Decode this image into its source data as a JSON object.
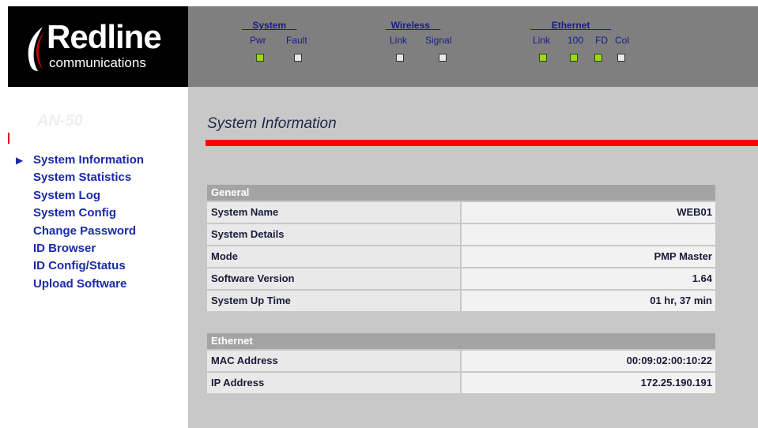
{
  "brand": {
    "name": "Redline",
    "tagline": "communications"
  },
  "status": {
    "groups": [
      {
        "title": "__System__",
        "items": [
          {
            "label": "Pwr",
            "state": "on"
          },
          {
            "label": "Fault",
            "state": "off"
          }
        ]
      },
      {
        "title": "_Wireless__",
        "items": [
          {
            "label": "Link",
            "state": "off"
          },
          {
            "label": "Signal",
            "state": "off"
          }
        ]
      },
      {
        "title": "____Ethernet____",
        "items": [
          {
            "label": "Link",
            "state": "on"
          },
          {
            "label": "100",
            "state": "on"
          },
          {
            "label": "FD",
            "state": "on"
          },
          {
            "label": "Col",
            "state": "off"
          }
        ]
      }
    ],
    "colors": {
      "led_on": "#9dd61a",
      "led_off": "#e8e8e8"
    }
  },
  "sidebar": {
    "model": "AN-50",
    "items": [
      {
        "label": "System Information",
        "active": true
      },
      {
        "label": "System Statistics"
      },
      {
        "label": "System Log"
      },
      {
        "label": "System Config"
      },
      {
        "label": "Change Password"
      },
      {
        "label": "ID Browser"
      },
      {
        "label": "ID Config/Status"
      },
      {
        "label": "Upload Software"
      }
    ]
  },
  "main": {
    "title": "System Information",
    "sections": [
      {
        "heading": "General",
        "rows": [
          {
            "label": "System Name",
            "value": "WEB01"
          },
          {
            "label": "System Details",
            "value": ""
          },
          {
            "label": "Mode",
            "value": "PMP Master"
          },
          {
            "label": "Software Version",
            "value": "1.64"
          },
          {
            "label": "System Up Time",
            "value": "01 hr, 37 min"
          }
        ]
      },
      {
        "heading": "Ethernet",
        "rows": [
          {
            "label": "MAC Address",
            "value": "00:09:02:00:10:22"
          },
          {
            "label": "IP Address",
            "value": "172.25.190.191"
          }
        ]
      }
    ]
  },
  "colors": {
    "accent": "#ff0000",
    "nav_link": "#1a2aa8",
    "header_bg": "#7f7f7f",
    "content_bg": "#c8c8c8"
  }
}
